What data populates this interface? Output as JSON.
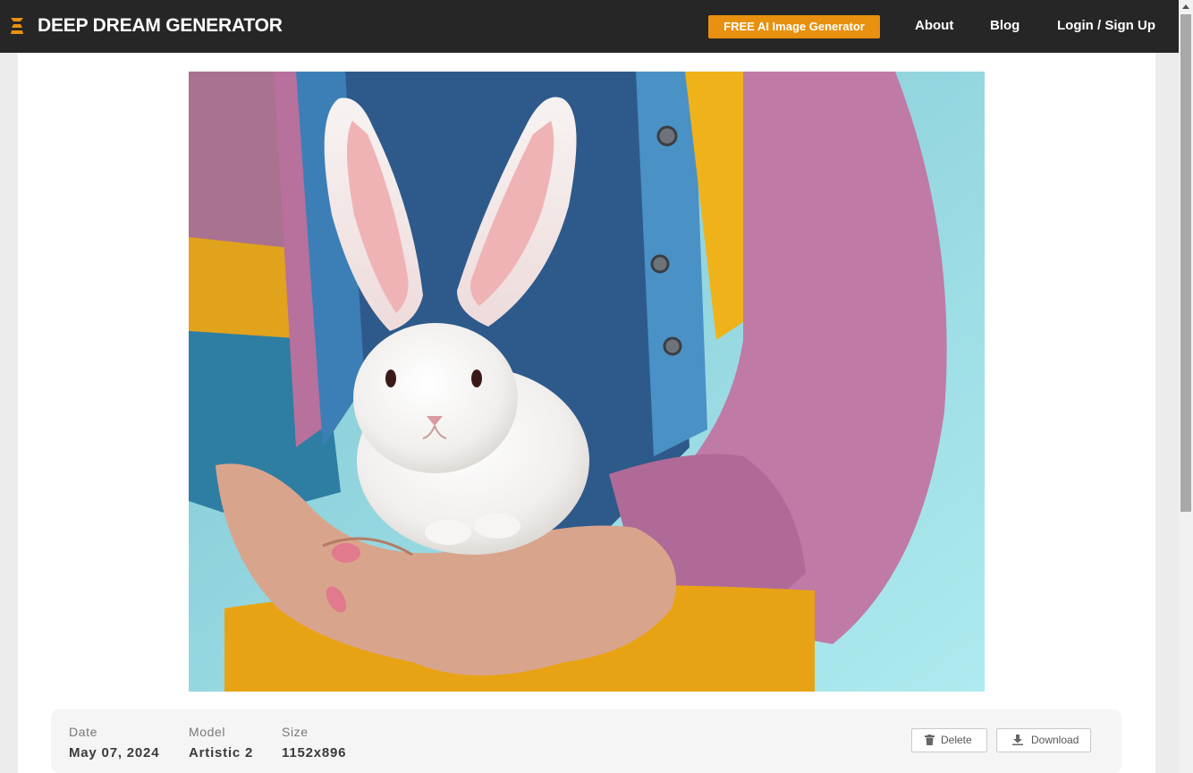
{
  "header": {
    "brand": "DEEP DREAM GENERATOR",
    "cta_label": "FREE AI Image Generator",
    "nav": {
      "about": "About",
      "blog": "Blog",
      "login": "Login / Sign Up"
    },
    "colors": {
      "bar": "#262626",
      "accent": "#e8900f"
    }
  },
  "image": {
    "subject": "white rabbit held in hands, colorful knit sweater"
  },
  "details": {
    "date_label": "Date",
    "date_value": "May 07, 2024",
    "model_label": "Model",
    "model_value": "Artistic 2",
    "size_label": "Size",
    "size_value": "1152x896"
  },
  "actions": {
    "delete_label": "Delete",
    "download_label": "Download"
  },
  "icons": {
    "logo": "ddg-logo-icon",
    "delete": "trash-icon",
    "download": "download-icon"
  }
}
